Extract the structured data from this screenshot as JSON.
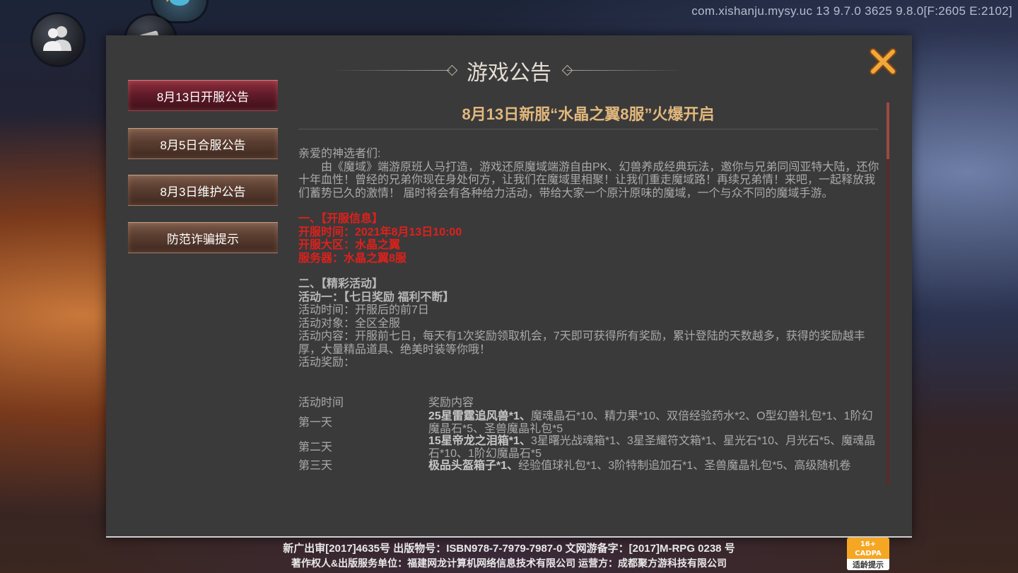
{
  "debug_overlay": "com.xishanju.mysy.uc  13  9.7.0  3625  9.8.0[F:2605 E:2102]",
  "hud": {
    "friends_icon": "friends-icon",
    "scroll_icon": "scroll-icon",
    "pet_icon": "pet-icon"
  },
  "modal": {
    "title": "游戏公告",
    "close_icon": "close-x-icon",
    "accent_color": "#e8a13a",
    "tabs": [
      {
        "label": "8月13日开服公告",
        "active": true
      },
      {
        "label": "8月5日合服公告",
        "active": false
      },
      {
        "label": "8月3日维护公告",
        "active": false
      },
      {
        "label": "防范诈骗提示",
        "active": false
      }
    ],
    "article": {
      "title": "8月13日新服“水晶之翼8服”火爆开启",
      "greeting": "亲爱的神选者们:",
      "intro": "由《魔域》端游原班人马打造，游戏还原魔域端游自由PK、幻兽养成经典玩法，邀你与兄弟同闯亚特大陆，还你十年血性！曾经的兄弟你现在身处何方，让我们在魔域里相聚！让我们重走魔域路！再续兄弟情！来吧，一起释放我们蓄势已久的激情！ 届时将会有各种给力活动，带给大家一个原汁原味的魔域，一个与众不同的魔域手游。",
      "section1": {
        "heading": "一、【开服信息】",
        "time": "开服时间：2021年8月13日10:00",
        "zone": "开服大区：水晶之翼",
        "server": "服务器：水晶之翼8服"
      },
      "section2": {
        "heading": "二、【精彩活动】",
        "activity1_title": "活动一：【七日奖励 福利不断】",
        "activity_time": "活动时间：开服后的前7日",
        "activity_target": "活动对象：全区全服",
        "activity_content": "活动内容：开服前七日，每天有1次奖励领取机会，7天即可获得所有奖励，累计登陆的天数越多，获得的奖励越丰厚，大量精品道具、绝美时装等你哦！",
        "activity_reward": "活动奖励："
      },
      "reward_table": {
        "headers": [
          "活动时间",
          "奖励内容"
        ],
        "rows": [
          {
            "day": "第一天",
            "bold": "25星雷霆追风兽*1、",
            "rest": "魔魂晶石*10、精力果*10、双倍经验药水*2、O型幻兽礼包*1、1阶幻魔晶石*5、圣兽魔晶礼包*5"
          },
          {
            "day": "第二天",
            "bold": "15星帝龙之泪箱*1、",
            "rest": "3星曙光战魂箱*1、3星圣耀符文箱*1、星光石*10、月光石*5、魔魂晶石*10、1阶幻魔晶石*5"
          },
          {
            "day": "第三天",
            "bold": "极品头盔箱子*1、",
            "rest": "经验值球礼包*1、3阶特制追加石*1、圣兽魔晶礼包*5、高级随机卷"
          }
        ]
      }
    }
  },
  "footer": {
    "line1": "新广出审[2017]4635号 出版物号：ISBN978-7-7979-7987-0 文网游备字：[2017]M-RPG 0238 号",
    "line2": "著作权人&出版服务单位：福建网龙计算机网络信息技术有限公司 运营方：成都聚方游科技有限公司",
    "age_rating": {
      "badge": "16+",
      "org": "CADPA",
      "tip": "适龄提示"
    }
  }
}
